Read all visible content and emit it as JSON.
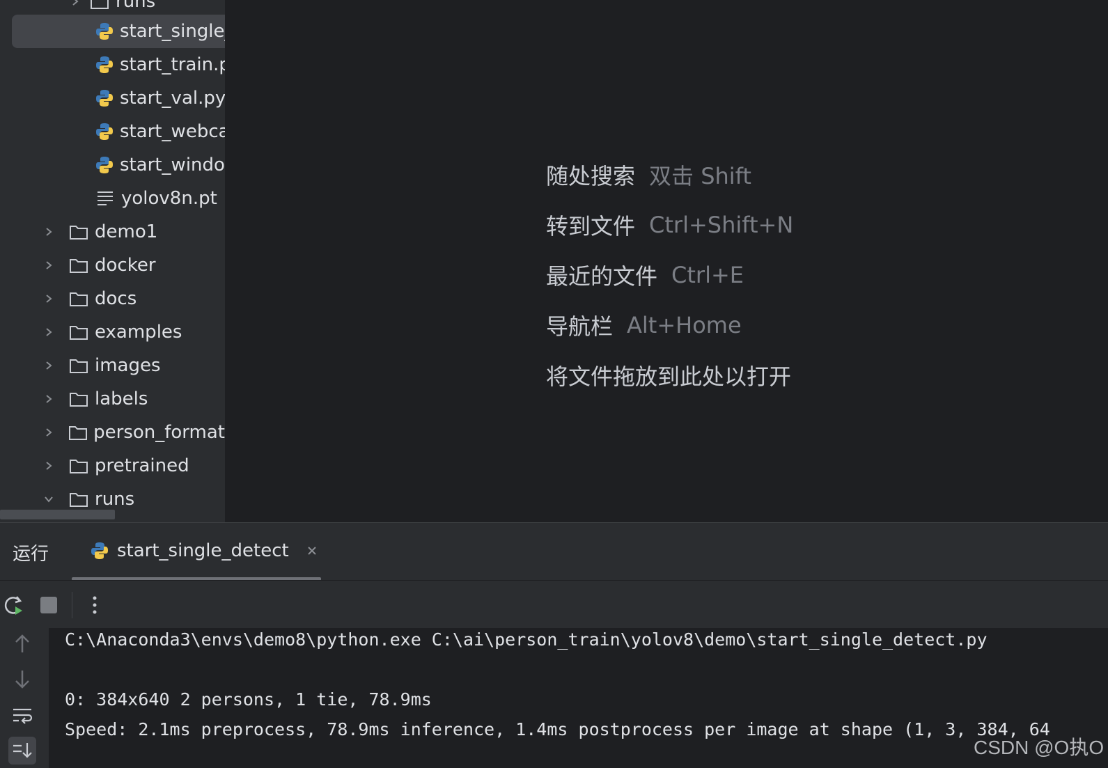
{
  "project_tree": {
    "items": [
      {
        "label": "runs",
        "type": "folder",
        "level": 2,
        "expanded": false,
        "partial": true
      },
      {
        "label": "start_single_",
        "type": "python",
        "level": 3,
        "selected": true
      },
      {
        "label": "start_train.py",
        "type": "python",
        "level": 3
      },
      {
        "label": "start_val.py",
        "type": "python",
        "level": 3
      },
      {
        "label": "start_webca",
        "type": "python",
        "level": 3
      },
      {
        "label": "start_windov",
        "type": "python",
        "level": 3
      },
      {
        "label": "yolov8n.pt",
        "type": "text",
        "level": 3
      },
      {
        "label": "demo1",
        "type": "folder",
        "level": 2,
        "expanded": false
      },
      {
        "label": "docker",
        "type": "folder",
        "level": 2,
        "expanded": false
      },
      {
        "label": "docs",
        "type": "folder",
        "level": 2,
        "expanded": false
      },
      {
        "label": "examples",
        "type": "folder",
        "level": 2,
        "expanded": false
      },
      {
        "label": "images",
        "type": "folder",
        "level": 2,
        "expanded": false
      },
      {
        "label": "labels",
        "type": "folder",
        "level": 2,
        "expanded": false
      },
      {
        "label": "person_format",
        "type": "folder",
        "level": 2,
        "expanded": false
      },
      {
        "label": "pretrained",
        "type": "folder",
        "level": 2,
        "expanded": false
      },
      {
        "label": "runs",
        "type": "folder",
        "level": 2,
        "expanded": true
      }
    ]
  },
  "editor_tips": [
    {
      "label": "随处搜索",
      "shortcut": "双击 Shift"
    },
    {
      "label": "转到文件",
      "shortcut": "Ctrl+Shift+N"
    },
    {
      "label": "最近的文件",
      "shortcut": "Ctrl+E"
    },
    {
      "label": "导航栏",
      "shortcut": "Alt+Home"
    },
    {
      "label": "将文件拖放到此处以打开",
      "shortcut": ""
    }
  ],
  "run_panel": {
    "title": "运行",
    "tab_label": "start_single_detect"
  },
  "console": {
    "lines": [
      "C:\\Anaconda3\\envs\\demo8\\python.exe C:\\ai\\person_train\\yolov8\\demo\\start_single_detect.py",
      "",
      "0: 384x640 2 persons, 1 tie, 78.9ms",
      "Speed: 2.1ms preprocess, 78.9ms inference, 1.4ms postprocess per image at shape (1, 3, 384, 64"
    ]
  },
  "watermark": "CSDN @O执O",
  "colors": {
    "panel_bg": "#2b2d30",
    "editor_bg": "#1e1f22",
    "text": "#dfe1e5",
    "muted": "#7b7e85",
    "py_blue": "#3d7ab8",
    "py_yellow": "#f2c94c",
    "run_green": "#5fb865"
  }
}
